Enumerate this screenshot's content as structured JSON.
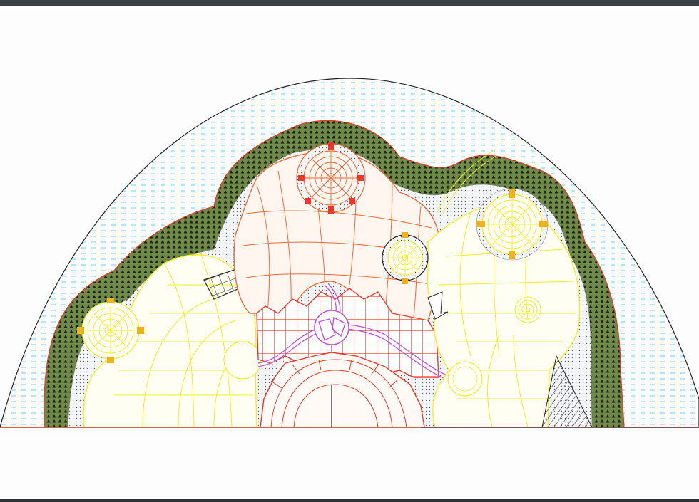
{
  "drawing": {
    "colors": {
      "background": "#fdfdfd",
      "water_hatch": "#7fcbe6",
      "vegetation_fill": "#6f8a4a",
      "vegetation_dots": "#111111",
      "paving_dots": "#5a6a7a",
      "red_zone": "#e8392b",
      "orange_zone": "#f06a3a",
      "yellow_zone": "#f2ee2a",
      "magenta_path": "#c052d8",
      "outline": "#222222",
      "pavilion_marker": "#f2b21a"
    }
  }
}
